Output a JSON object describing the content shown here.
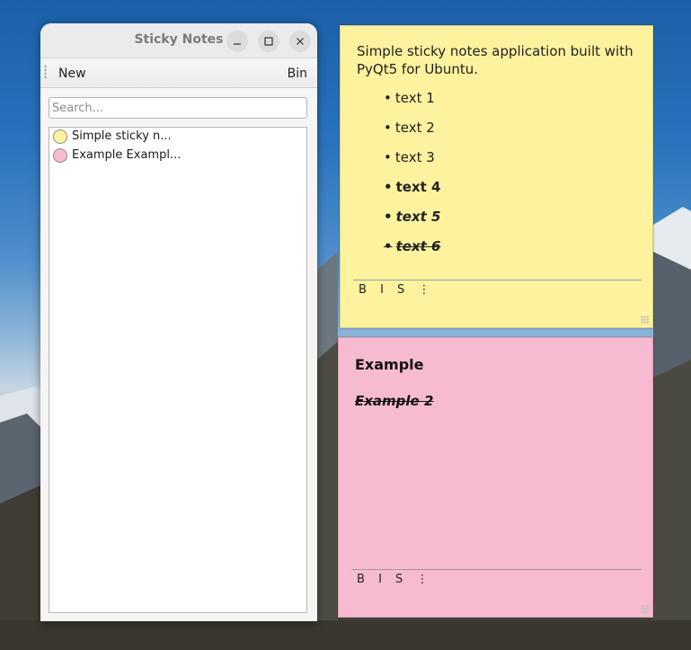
{
  "window": {
    "title": "Sticky Notes",
    "minimize_icon": "minimize-icon",
    "maximize_icon": "maximize-icon",
    "close_icon": "close-icon"
  },
  "menubar": {
    "new_label": "New",
    "bin_label": "Bin"
  },
  "search": {
    "placeholder": "Search..."
  },
  "notes_list": [
    {
      "label": "Simple sticky n...",
      "color": "#fdf29e"
    },
    {
      "label": "Example  Exampl...",
      "color": "#f7bbd1"
    }
  ],
  "yellow_note": {
    "color": "#fdf29e",
    "intro": "Simple sticky notes application built with PyQt5 for Ubuntu.",
    "items": [
      "text 1",
      "text 2",
      "text 3",
      "text 4",
      "text 5",
      "text 6"
    ],
    "toolbar": {
      "bold": "B",
      "italic": "I",
      "strike": "S",
      "more": "⋮"
    }
  },
  "pink_note": {
    "color": "#f7bbd1",
    "heading": "Example",
    "subheading": "Example 2",
    "toolbar": {
      "bold": "B",
      "italic": "I",
      "strike": "S",
      "more": "⋮"
    }
  }
}
